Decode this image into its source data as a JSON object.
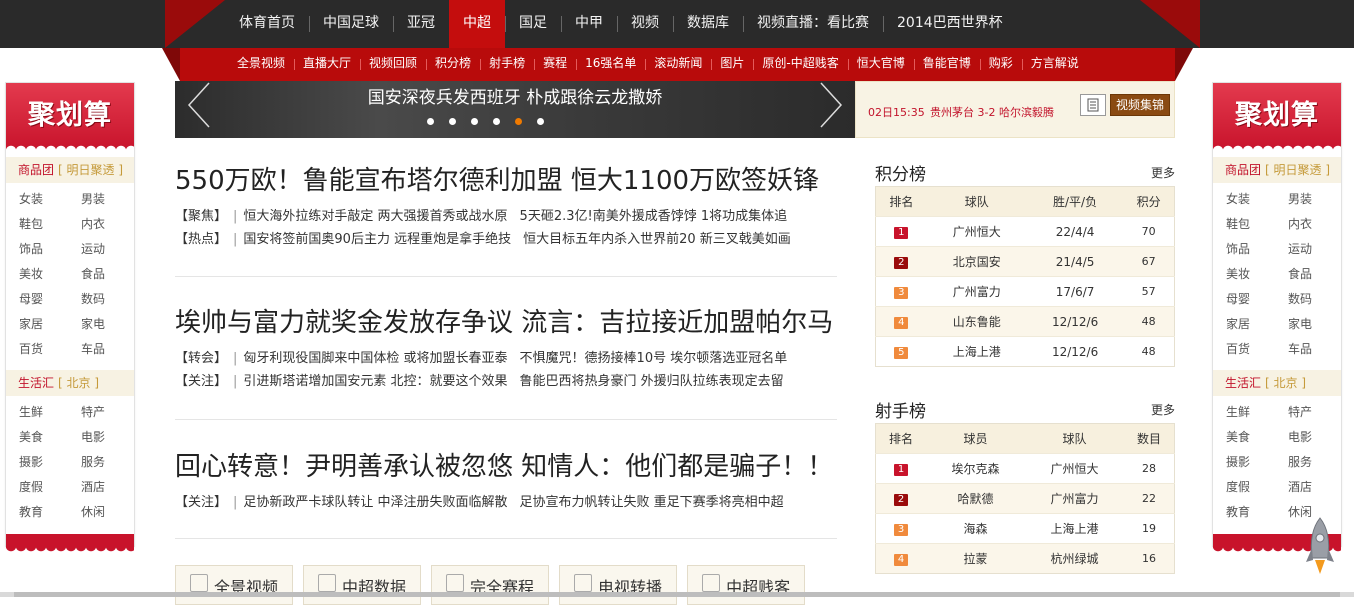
{
  "top_nav": [
    "体育首页",
    "中国足球",
    "亚冠",
    "中超",
    "国足",
    "中甲",
    "视频",
    "数据库",
    "视频直播：看比赛",
    "2014巴西世界杯"
  ],
  "top_nav_active": "中超",
  "sub_nav": [
    "全景视频",
    "直播大厅",
    "视频回顾",
    "积分榜",
    "射手榜",
    "赛程",
    "16强名单",
    "滚动新闻",
    "图片",
    "原创-中超贱客",
    "恒大官博",
    "鲁能官博",
    "购彩",
    "方言解说"
  ],
  "side_banner": {
    "title": "聚划算",
    "group1": {
      "name": "商品团",
      "sub": "[ 明日聚透 ]",
      "items": [
        "女装",
        "男装",
        "鞋包",
        "内衣",
        "饰品",
        "运动",
        "美妆",
        "食品",
        "母婴",
        "数码",
        "家居",
        "家电",
        "百货",
        "车品"
      ]
    },
    "group2": {
      "name": "生活汇",
      "sub": "[ 北京 ]",
      "items": [
        "生鲜",
        "特产",
        "美食",
        "电影",
        "摄影",
        "服务",
        "度假",
        "酒店",
        "教育",
        "休闲"
      ]
    }
  },
  "slider": {
    "caption": "国安深夜兵发西班牙 朴成跟徐云龙撒娇",
    "dot_count": 6,
    "active_dot": 5
  },
  "score_strip": {
    "time": "02日15:35",
    "match": "贵州茅台 3-2 哈尔滨毅腾",
    "video_button": "视频集锦"
  },
  "stories": [
    {
      "title": "550万欧！鲁能宣布塔尔德利加盟 恒大1100万欧签妖锋",
      "rows": [
        {
          "tag": "【聚焦】",
          "a": "恒大海外拉练对手敲定 两大强援首秀或战水原",
          "b": "5天砸2.3亿!南美外援成香饽饽 1将功成集体追"
        },
        {
          "tag": "【热点】",
          "a": "国安将签前国奥90后主力 远程重炮是拿手绝技",
          "b": "恒大目标五年内杀入世界前20 新三叉戟美如画"
        }
      ]
    },
    {
      "title": "埃帅与富力就奖金发放存争议 流言：吉拉接近加盟帕尔马",
      "rows": [
        {
          "tag": "【转会】",
          "a": "匈牙利现役国脚来中国体检 或将加盟长春亚泰",
          "b": "不惧魔咒！德扬接棒10号 埃尔顿落选亚冠名单"
        },
        {
          "tag": "【关注】",
          "a": "引进斯塔诺增加国安元素 北控：就要这个效果",
          "b": "鲁能巴西将热身豪门 外援归队拉练表现定去留"
        }
      ]
    },
    {
      "title": "回心转意！尹明善承认被忽悠 知情人：他们都是骗子！！",
      "rows": [
        {
          "tag": "【关注】",
          "a": "足协新政严卡球队转让 中泽注册失败面临解散",
          "b": "足协宣布力帆转让失败 重足下赛季将亮相中超"
        }
      ]
    }
  ],
  "quick_links": [
    "全景视频",
    "中超数据",
    "完全赛程",
    "电视转播",
    "中超贱客"
  ],
  "standings": {
    "title": "积分榜",
    "more": "更多",
    "headers": [
      "排名",
      "球队",
      "胜/平/负",
      "积分"
    ],
    "rows": [
      {
        "rank": "1",
        "team": "广州恒大",
        "record": "22/4/4",
        "points": "70"
      },
      {
        "rank": "2",
        "team": "北京国安",
        "record": "21/4/5",
        "points": "67"
      },
      {
        "rank": "3",
        "team": "广州富力",
        "record": "17/6/7",
        "points": "57"
      },
      {
        "rank": "4",
        "team": "山东鲁能",
        "record": "12/12/6",
        "points": "48"
      },
      {
        "rank": "5",
        "team": "上海上港",
        "record": "12/12/6",
        "points": "48"
      }
    ]
  },
  "scorers": {
    "title": "射手榜",
    "more": "更多",
    "headers": [
      "排名",
      "球员",
      "球队",
      "数目"
    ],
    "rows": [
      {
        "rank": "1",
        "player": "埃尔克森",
        "team": "广州恒大",
        "goals": "28"
      },
      {
        "rank": "2",
        "player": "哈默德",
        "team": "广州富力",
        "goals": "22"
      },
      {
        "rank": "3",
        "player": "海森",
        "team": "上海上港",
        "goals": "19"
      },
      {
        "rank": "4",
        "player": "拉蒙",
        "team": "杭州绿城",
        "goals": "16"
      }
    ]
  },
  "colors": {
    "brand_red": "#c40d0d",
    "dark_bar": "#2a2a2a",
    "cream": "#f7f0de",
    "slider_active_dot": "#f07a00"
  }
}
